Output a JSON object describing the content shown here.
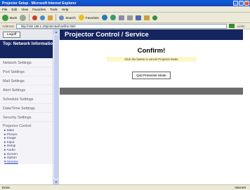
{
  "window": {
    "title": "Projector Setup - Microsoft Internet Explorer"
  },
  "menubar": {
    "items": [
      "File",
      "Edit",
      "View",
      "Favorites",
      "Tools",
      "Help"
    ]
  },
  "toolbar": {
    "back_label": "Back",
    "search_label": "Search",
    "favorites_label": "Favorites"
  },
  "addressbar": {
    "label": "Address",
    "value": "http://192.168.1.10/protected/confirm.html",
    "links_label": "Links"
  },
  "sidebar": {
    "logoff_label": "Logoff",
    "top_label": "Top: Network Information",
    "items": [
      "Network Settings",
      "Port Settings",
      "Mail Settings",
      "Alert Settings",
      "Schedule Settings",
      "Date/Time Settings",
      "Security Settings"
    ],
    "projector_control_label": "Projector Control",
    "sub_items": [
      "Main",
      "Picture",
      "Image",
      "Input",
      "Setup",
      "Audio",
      "Screen",
      "Option",
      "Service"
    ]
  },
  "main": {
    "heading": "Projector Control / Service",
    "confirm_title": "Confirm!",
    "instruction": "Click the button to cancel Projector Mode",
    "quit_button_label": "Quit Presenter Mode"
  },
  "statusbar": {
    "status": "Done",
    "zone": "Internet"
  },
  "colors": {
    "nav_blue": "#15255f",
    "title_blue": "#0a5fd8",
    "gray_band": "#6c6c6c",
    "instruction_bg": "#fdf7c8"
  }
}
